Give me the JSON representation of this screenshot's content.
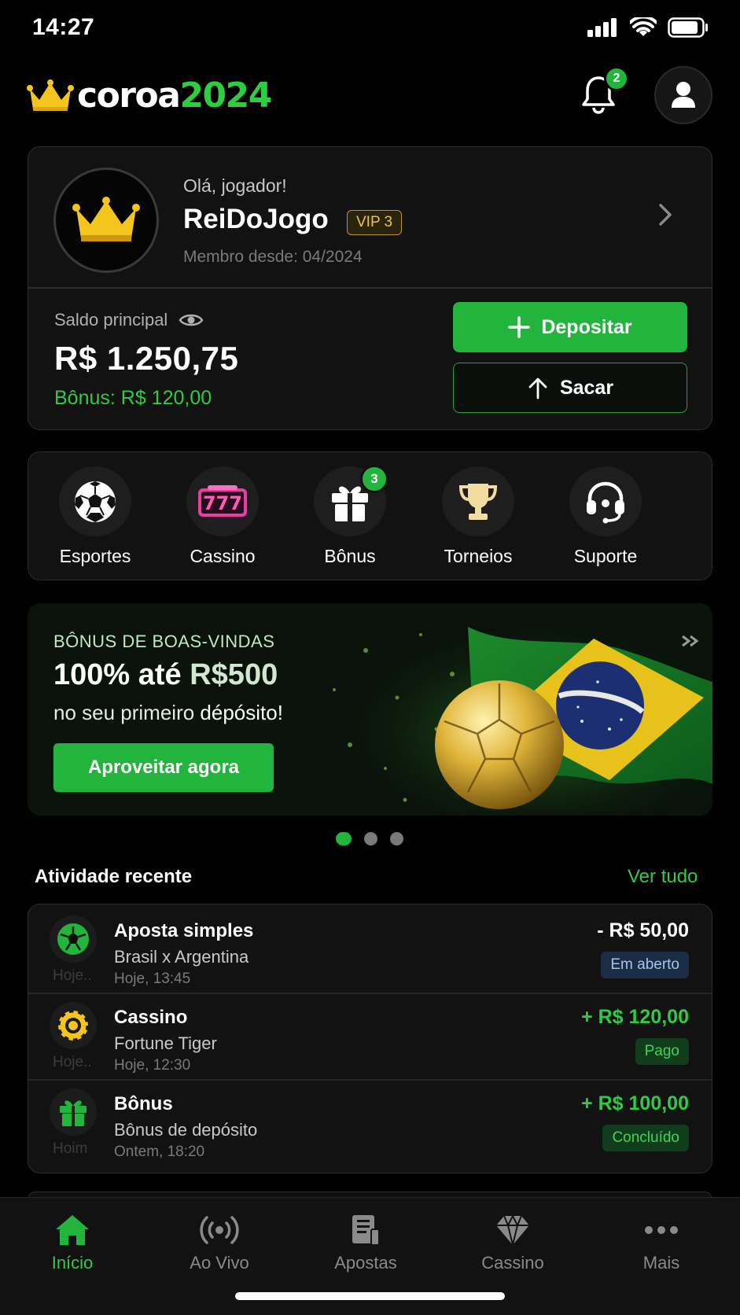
{
  "status_bar": {
    "time": "14:27"
  },
  "header": {
    "logo_white": "coroa",
    "logo_green": "2024",
    "notifications_badge": "2"
  },
  "profile": {
    "greeting": "Olá, jogador!",
    "username": "ReiDoJogo",
    "vip": "VIP 3",
    "member_since": "Membro desde: 04/2024",
    "balance_label": "Saldo principal",
    "balance": "R$ 1.250,75",
    "bonus": "Bônus: R$ 120,00",
    "deposit_label": "Depositar",
    "withdraw_label": "Sacar"
  },
  "quick_nav": [
    {
      "label": "Esportes",
      "icon": "soccer-ball-icon"
    },
    {
      "label": "Cassino",
      "icon": "slot-777-icon"
    },
    {
      "label": "Bônus",
      "icon": "gift-icon",
      "badge": "3"
    },
    {
      "label": "Torneios",
      "icon": "trophy-icon"
    },
    {
      "label": "Suporte",
      "icon": "headset-icon"
    }
  ],
  "banner": {
    "eyebrow": "BÔNUS DE BOAS-VINDAS",
    "title_a": "100% até ",
    "title_b": "R$500",
    "subtitle_a": "no seu primeiro ",
    "subtitle_b": "dépósito!",
    "cta": "Aproveitar agora"
  },
  "recent": {
    "title": "Atividade recente",
    "see_all": "Ver tudo",
    "items": [
      {
        "title": "Aposta simples",
        "subtitle": "Brasil x Argentina",
        "time": "Hoje, 13:45",
        "ghost": "Hoje..",
        "amount": "- R$ 50,00",
        "status": "Em aberto",
        "icon": "soccer-ball-icon"
      },
      {
        "title": "Cassino",
        "subtitle": "Fortune Tiger",
        "time": "Hoje, 12:30",
        "ghost": "Hoje..",
        "amount": "+ R$ 120,00",
        "status": "Pago",
        "icon": "casino-chip-icon"
      },
      {
        "title": "Bônus",
        "subtitle": "Bônus de depósito",
        "time": "Ontem, 18:20",
        "ghost": "Hoim",
        "amount": "+ R$ 100,00",
        "status": "Concluído",
        "icon": "gift-icon"
      }
    ]
  },
  "bottom_nav": [
    {
      "label": "Início",
      "icon": "home-icon",
      "active": true
    },
    {
      "label": "Ao Vivo",
      "icon": "live-broadcast-icon"
    },
    {
      "label": "Apostas",
      "icon": "bet-slip-icon"
    },
    {
      "label": "Cassino",
      "icon": "diamond-icon"
    },
    {
      "label": "Mais",
      "icon": "more-dots-icon"
    }
  ],
  "colors": {
    "accent": "#22b43c",
    "accent_text": "#2ecc40",
    "background": "#000000",
    "card": "#121212",
    "vip_gold": "#e9c24c"
  }
}
